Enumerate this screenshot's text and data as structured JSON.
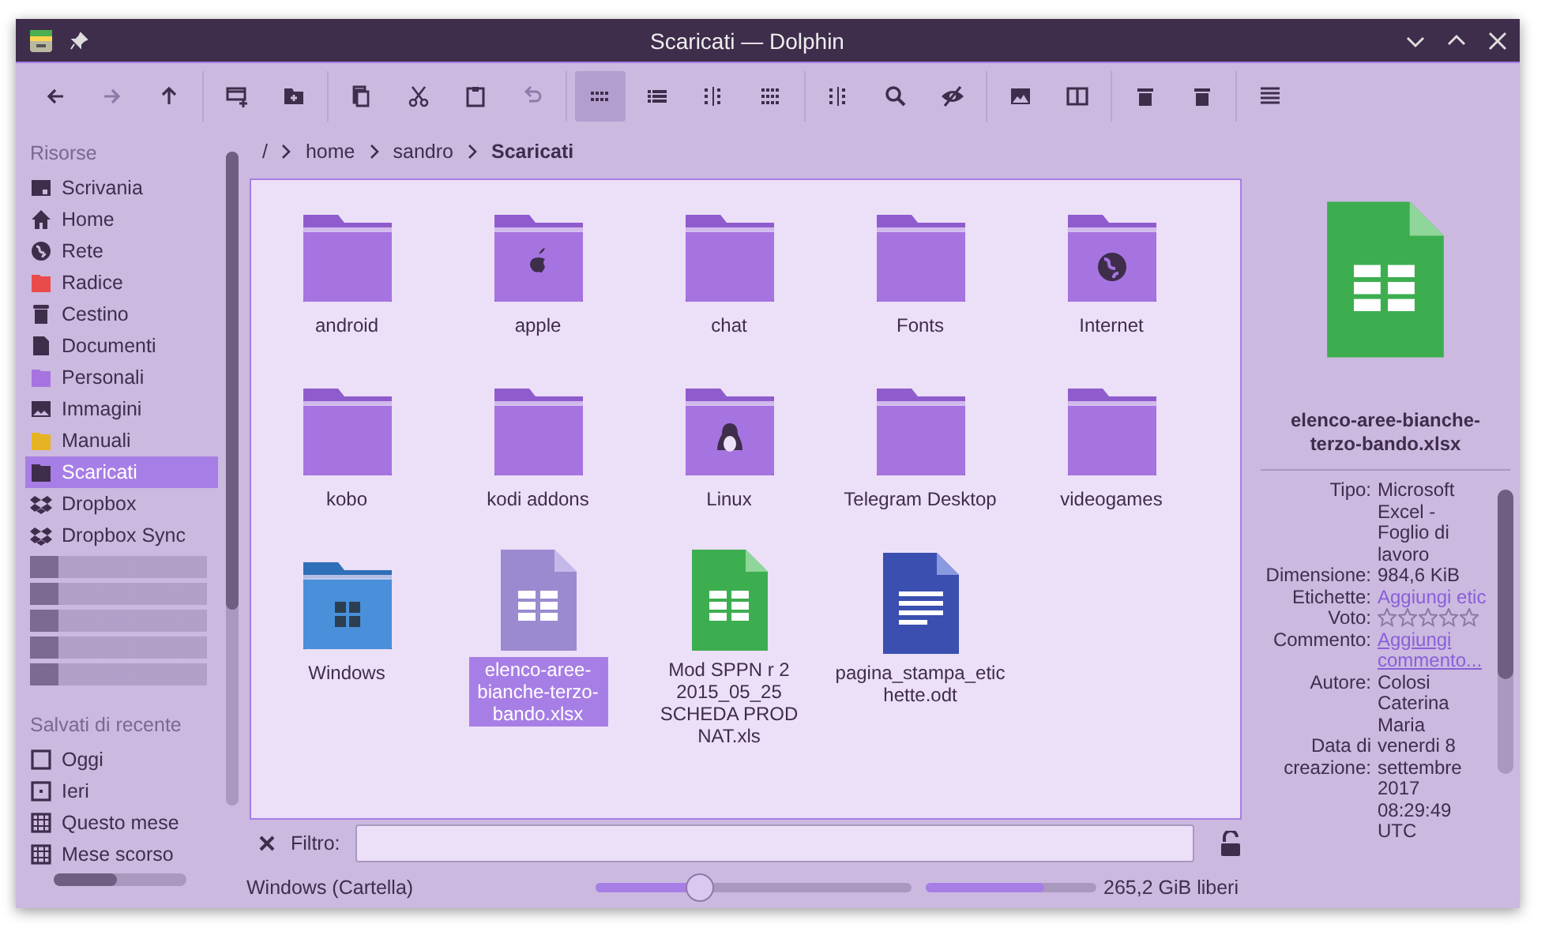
{
  "window": {
    "title": "Scaricati — Dolphin"
  },
  "toolbar": [
    {
      "selected": false,
      "disabled": false
    },
    {
      "selected": false,
      "disabled": true
    },
    {
      "selected": false,
      "disabled": false
    },
    {
      "selected": false,
      "disabled": false
    },
    {
      "selected": false,
      "disabled": false
    },
    {
      "selected": false,
      "disabled": false
    },
    {
      "selected": false,
      "disabled": false
    },
    {
      "selected": false,
      "disabled": false
    },
    {
      "selected": false,
      "disabled": true
    },
    {
      "selected": true,
      "disabled": false
    },
    {
      "selected": false,
      "disabled": false
    },
    {
      "selected": false,
      "disabled": false
    },
    {
      "selected": false,
      "disabled": false
    },
    {
      "selected": false,
      "disabled": false
    },
    {
      "selected": false,
      "disabled": false
    },
    {
      "selected": false,
      "disabled": false
    },
    {
      "selected": false,
      "disabled": false
    },
    {
      "selected": false,
      "disabled": false
    },
    {
      "selected": false,
      "disabled": false
    },
    {
      "selected": false,
      "disabled": false
    },
    {
      "selected": false,
      "disabled": false
    }
  ],
  "sidebar": {
    "sections": [
      {
        "title": "Risorse",
        "items": [
          {
            "label": "Scrivania",
            "kind": "desktop",
            "selected": false
          },
          {
            "label": "Home",
            "kind": "home",
            "selected": false
          },
          {
            "label": "Rete",
            "kind": "network",
            "selected": false
          },
          {
            "label": "Radice",
            "kind": "folder",
            "color": "#e94b4b",
            "selected": false
          },
          {
            "label": "Cestino",
            "kind": "trash",
            "selected": false
          },
          {
            "label": "Documenti",
            "kind": "document",
            "selected": false
          },
          {
            "label": "Personali",
            "kind": "folder",
            "color": "#a674e0",
            "selected": false
          },
          {
            "label": "Immagini",
            "kind": "image",
            "selected": false
          },
          {
            "label": "Manuali",
            "kind": "folder",
            "color": "#e6b422",
            "selected": false
          },
          {
            "label": "Scaricati",
            "kind": "folder",
            "color": "#3f2d4c",
            "selected": true
          },
          {
            "label": "Dropbox",
            "kind": "dropbox",
            "selected": false
          },
          {
            "label": "Dropbox Sync",
            "kind": "dropbox",
            "selected": false
          },
          {
            "kind": "blurred",
            "selected": false
          },
          {
            "kind": "blurred",
            "selected": false
          },
          {
            "kind": "blurred",
            "selected": false
          },
          {
            "kind": "blurred",
            "selected": false
          },
          {
            "kind": "blurred",
            "selected": false
          }
        ]
      },
      {
        "title": "Salvati di recente",
        "items": [
          {
            "label": "Oggi",
            "kind": "day",
            "selected": false
          },
          {
            "label": "Ieri",
            "kind": "yesterday",
            "selected": false
          },
          {
            "label": "Questo mese",
            "kind": "month",
            "selected": false
          },
          {
            "label": "Mese scorso",
            "kind": "month",
            "selected": false
          }
        ]
      }
    ]
  },
  "breadcrumb": [
    {
      "label": "/",
      "current": false
    },
    {
      "label": "home",
      "current": false
    },
    {
      "label": "sandro",
      "current": false
    },
    {
      "label": "Scaricati",
      "current": true
    }
  ],
  "files": [
    {
      "name": "android",
      "kind": "folder",
      "selected": false
    },
    {
      "name": "apple",
      "kind": "folder-apple",
      "selected": false
    },
    {
      "name": "chat",
      "kind": "folder",
      "selected": false
    },
    {
      "name": "Fonts",
      "kind": "folder",
      "selected": false
    },
    {
      "name": "Internet",
      "kind": "folder-globe",
      "selected": false
    },
    {
      "name": "kobo",
      "kind": "folder",
      "selected": false
    },
    {
      "name": "kodi addons",
      "kind": "folder",
      "selected": false
    },
    {
      "name": "Linux",
      "kind": "folder-linux",
      "selected": false
    },
    {
      "name": "Telegram Desktop",
      "kind": "folder",
      "selected": false
    },
    {
      "name": "videogames",
      "kind": "folder",
      "selected": false
    },
    {
      "name": "Windows",
      "kind": "folder-windows",
      "selected": false
    },
    {
      "name": "elenco-aree-bianche-terzo-bando.xlsx",
      "kind": "sheet-violet",
      "selected": true
    },
    {
      "name": "Mod SPPN r 2 2015_05_25 SCHEDA PROD NAT.xls",
      "kind": "sheet-green",
      "selected": false
    },
    {
      "name": "pagina_stampa_etichette.odt",
      "kind": "document",
      "selected": false
    }
  ],
  "filter": {
    "label": "Filtro:"
  },
  "status_bar": {
    "text": "Windows (Cartella)",
    "zoom": {
      "level": 0.33
    },
    "disk": {
      "level": 0.7,
      "text": "265,2 GiB liberi"
    }
  },
  "info_panel": {
    "file_name": "elenco-aree-bianche-terzo-bando.xlsx",
    "fields": [
      {
        "label": "Tipo:",
        "kind": "text",
        "value": "Microsoft Excel - Foglio di lavoro"
      },
      {
        "label": "Dimensione:",
        "kind": "text",
        "value": "984,6 KiB"
      },
      {
        "label": "Etichette:",
        "kind": "link",
        "value": "Aggiungi etic"
      },
      {
        "label": "Voto:",
        "kind": "stars",
        "stars": 0
      },
      {
        "label": "Commento:",
        "kind": "underlined-link",
        "value": "Aggiungi commento..."
      },
      {
        "label": "Autore:",
        "kind": "text",
        "value": "Colosi Caterina Maria"
      },
      {
        "label": "Data di creazione:",
        "kind": "text",
        "value": "venerdi 8 settembre 2017 08:29:49 UTC"
      }
    ]
  }
}
